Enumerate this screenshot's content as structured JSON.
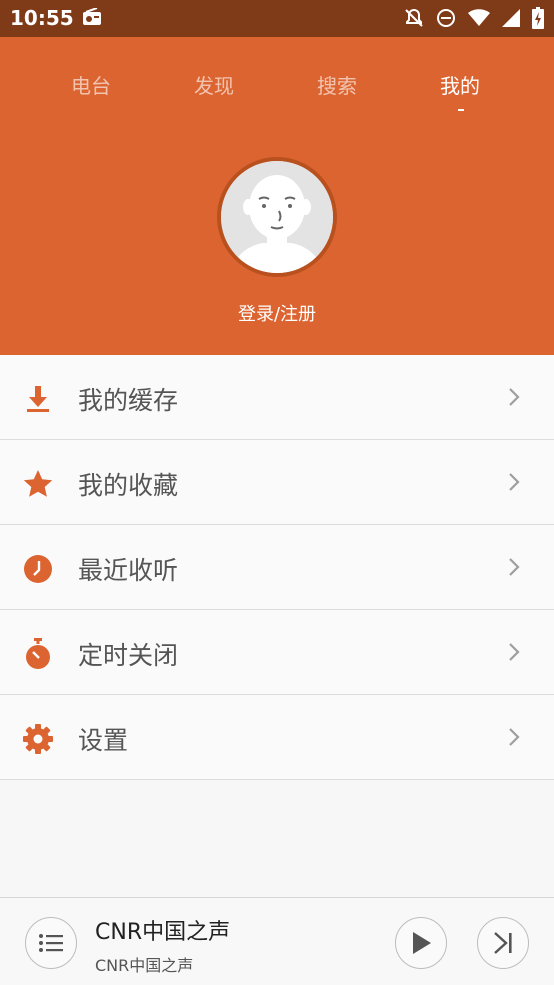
{
  "status_bar": {
    "time": "10:55",
    "icons": [
      "radio-icon",
      "notifications-off-icon",
      "do-not-disturb-icon",
      "wifi-icon",
      "signal-icon",
      "battery-charging-icon"
    ]
  },
  "tabs": [
    {
      "label": "电台",
      "active": false
    },
    {
      "label": "发现",
      "active": false
    },
    {
      "label": "搜索",
      "active": false
    },
    {
      "label": "我的",
      "active": true
    }
  ],
  "profile": {
    "login_label": "登录/注册"
  },
  "menu": [
    {
      "label": "我的缓存",
      "icon": "download-icon"
    },
    {
      "label": "我的收藏",
      "icon": "star-icon"
    },
    {
      "label": "最近收听",
      "icon": "clock-icon"
    },
    {
      "label": "定时关闭",
      "icon": "timer-icon"
    },
    {
      "label": "设置",
      "icon": "gear-icon"
    }
  ],
  "player": {
    "title": "CNR中国之声",
    "subtitle": "CNR中国之声"
  },
  "colors": {
    "accent": "#dc6430",
    "status_bar": "#7f3a18"
  }
}
